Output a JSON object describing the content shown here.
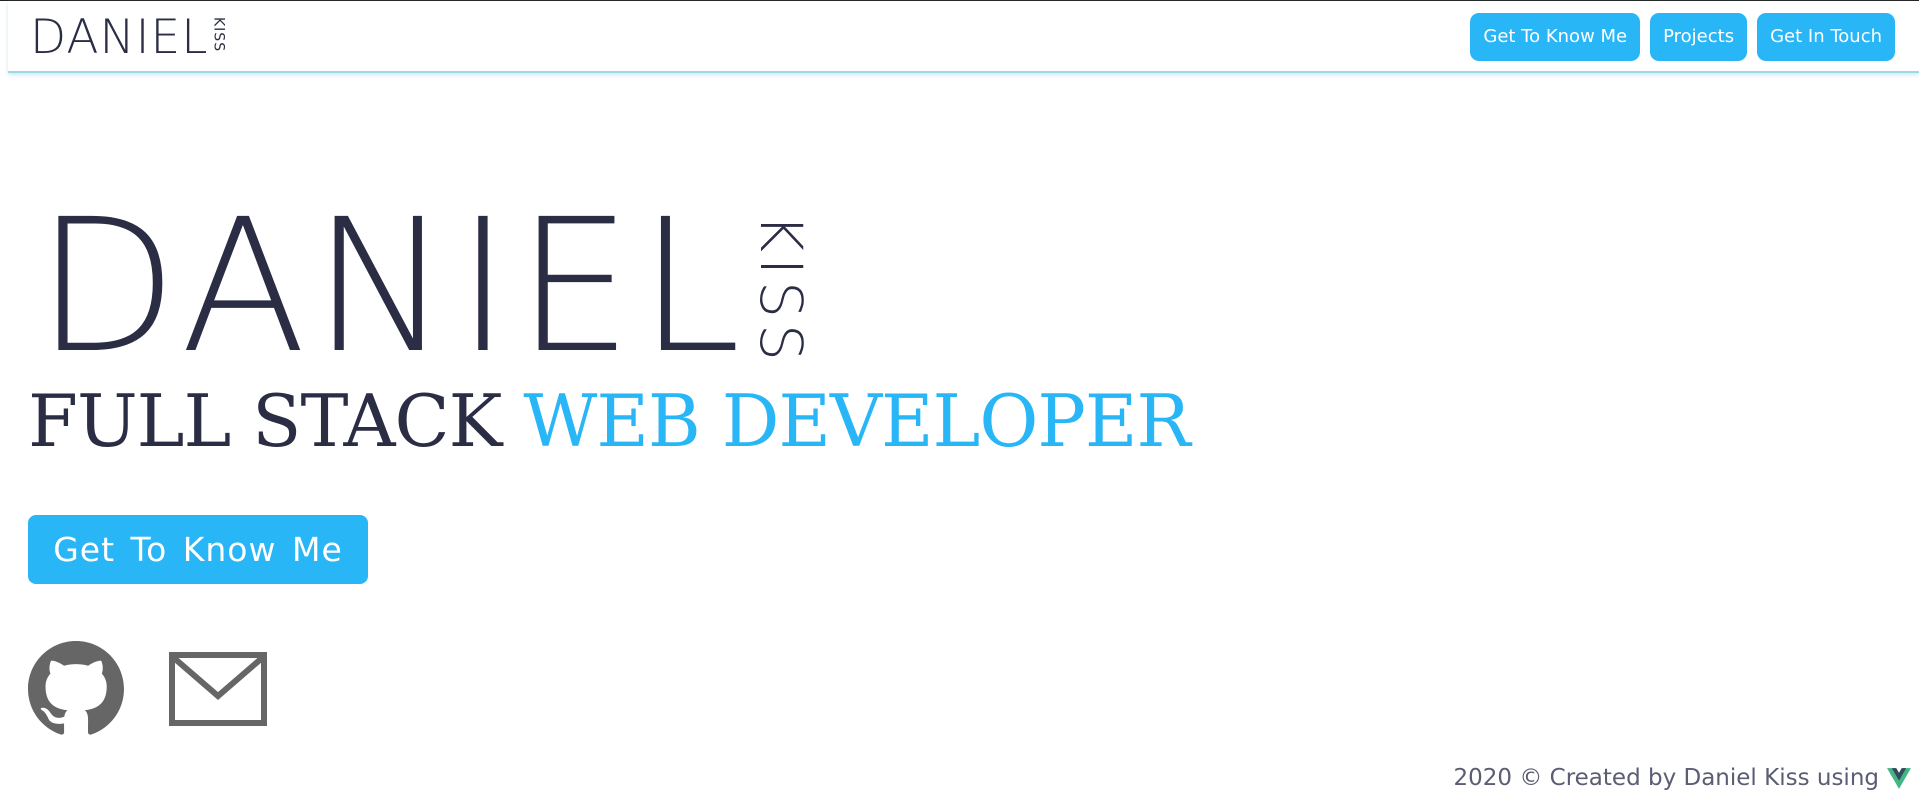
{
  "nav": {
    "logo_first": "DANIEL",
    "logo_last": "KISS",
    "links": [
      {
        "label": "Get To Know Me"
      },
      {
        "label": "Projects"
      },
      {
        "label": "Get In Touch"
      }
    ]
  },
  "hero": {
    "name_first": "DANIEL",
    "name_last": "KISS",
    "title_dark": "FULL STACK",
    "title_accent": "WEB DEVELOPER",
    "cta_label": "Get To Know Me"
  },
  "social": [
    {
      "icon": "github-icon"
    },
    {
      "icon": "mail-icon"
    }
  ],
  "footer": {
    "text": "2020 © Created by Daniel Kiss using",
    "icon": "vue-logo-icon"
  },
  "colors": {
    "accent": "#29b6f6",
    "text_dark": "#2a2d44",
    "icon_gray": "#666666",
    "vue_green": "#41b883",
    "vue_dark": "#35495e"
  }
}
